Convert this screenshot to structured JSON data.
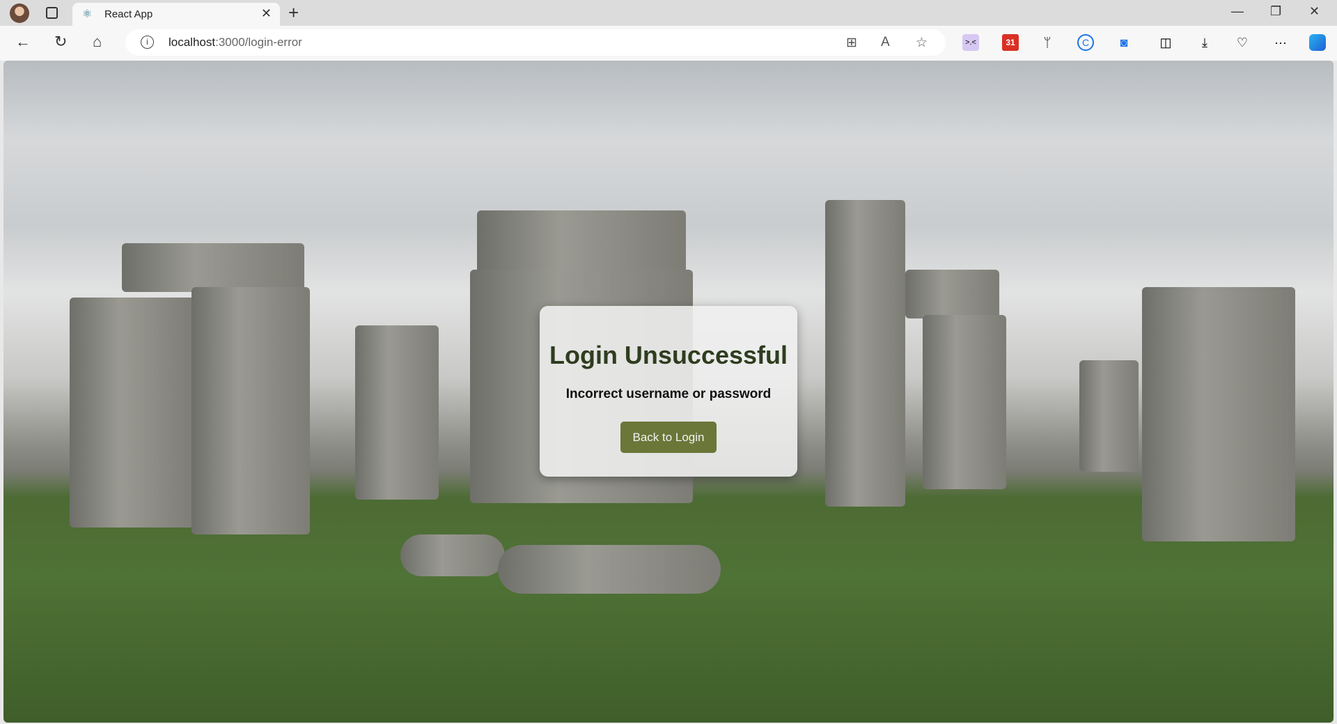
{
  "browser": {
    "tab": {
      "title": "React App",
      "favicon": "react-icon"
    },
    "address": {
      "host": "localhost",
      "path": ":3000/login-error"
    },
    "extensions": [
      "extension-face-icon",
      "gmail-calendar-icon",
      "sprout-icon",
      "c-extension-icon",
      "screen-capture-icon"
    ],
    "calendar_badge": "31"
  },
  "page": {
    "title": "Login Unsuccessful",
    "message": "Incorrect username or password",
    "button_label": "Back to Login",
    "colors": {
      "title": "#2f3d1f",
      "button": "#6a7738"
    }
  }
}
